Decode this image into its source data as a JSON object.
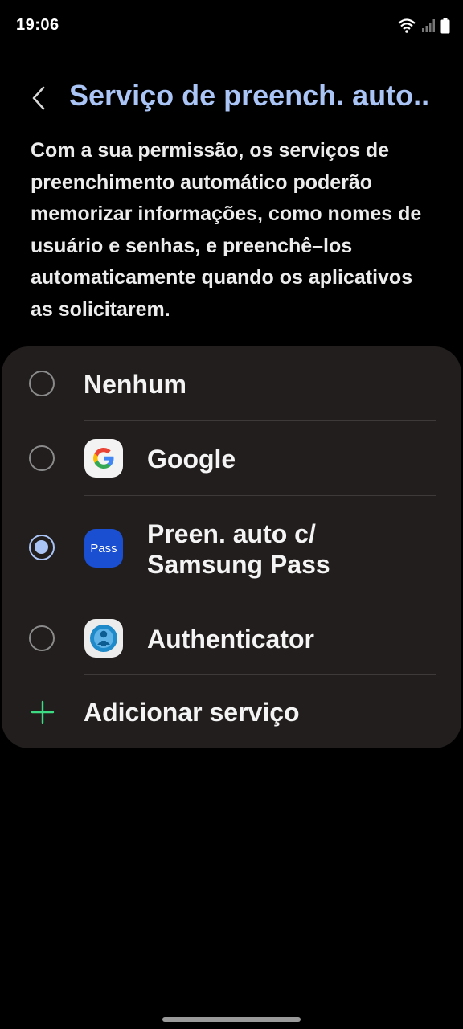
{
  "status_bar": {
    "time": "19:06"
  },
  "header": {
    "title": "Serviço de preench. auto..."
  },
  "description": "Com a sua permissão, os serviços de preenchimento automático poderão memorizar informações, como nomes de usuário e senhas, e preenchê–los automaticamente quando os aplicativos as solicitarem.",
  "options": [
    {
      "label": "Nenhum",
      "selected": false,
      "icon": null
    },
    {
      "label": "Google",
      "selected": false,
      "icon": "google-icon"
    },
    {
      "label_line1": "Preen. auto c/",
      "label_line2": "Samsung Pass",
      "selected": true,
      "icon": "samsung-pass-icon",
      "icon_text": "Pass"
    },
    {
      "label": "Authenticator",
      "selected": false,
      "icon": "authenticator-icon"
    }
  ],
  "add_service": {
    "label": "Adicionar serviço",
    "icon": "plus-icon"
  },
  "colors": {
    "accent": "#a9c4f5",
    "card": "#221e1d",
    "plus": "#3ddc84",
    "pass_bg": "#1a4fd1"
  }
}
